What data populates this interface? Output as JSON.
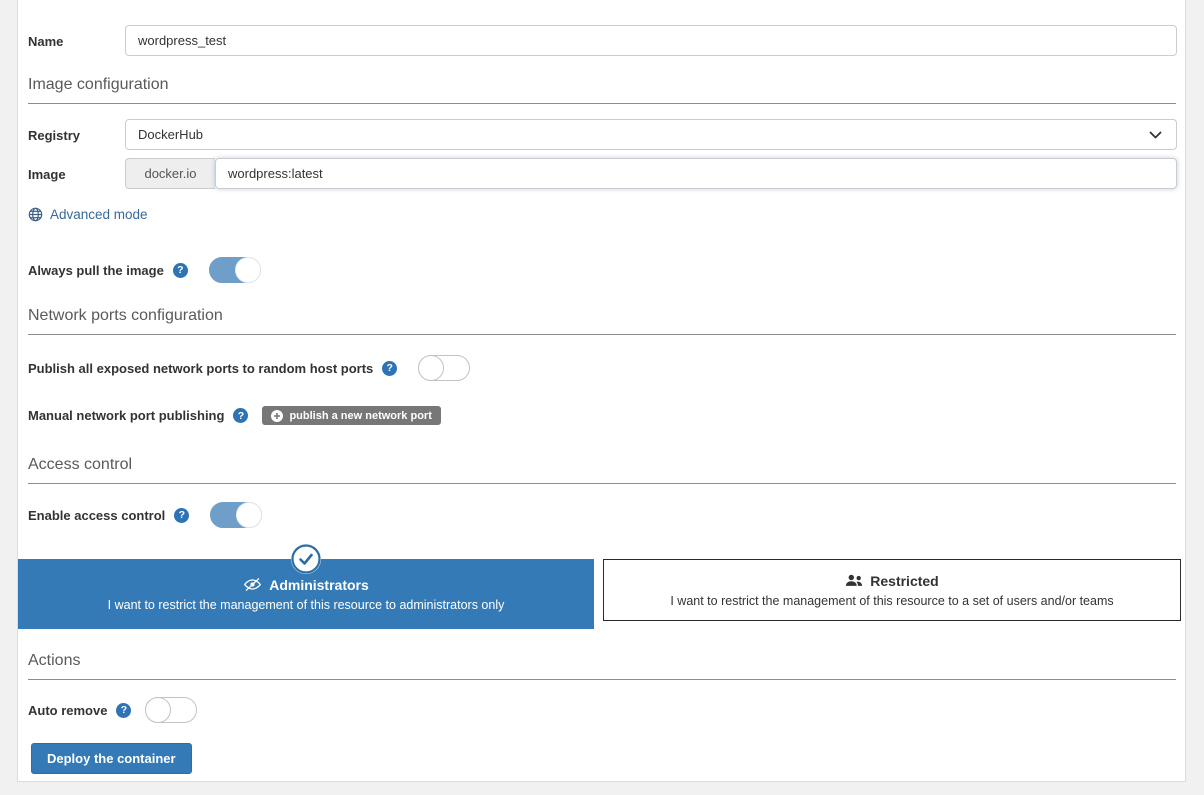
{
  "colors": {
    "accent": "#337ab7",
    "toggle_on": "#6f9fc9",
    "muted_button": "#777777",
    "link": "#37699b",
    "section_underline": "#8c8c8c"
  },
  "name_row": {
    "label": "Name",
    "value": "wordpress_test"
  },
  "image_config": {
    "title": "Image configuration",
    "registry": {
      "label": "Registry",
      "value": "DockerHub"
    },
    "image": {
      "label": "Image",
      "prefix": "docker.io",
      "value": "wordpress:latest"
    },
    "advanced_mode_label": "Advanced mode",
    "advanced_mode_icon": "globe-icon"
  },
  "always_pull": {
    "label": "Always pull the image",
    "enabled": true
  },
  "network": {
    "title": "Network ports configuration",
    "publish_all": {
      "label": "Publish all exposed network ports to random host ports",
      "enabled": false
    },
    "manual": {
      "label": "Manual network port publishing",
      "button_label": "publish a new network port",
      "button_icon": "plus-circle-icon"
    }
  },
  "access_control": {
    "title": "Access control",
    "enable": {
      "label": "Enable access control",
      "enabled": true
    },
    "options": [
      {
        "title": "Administrators",
        "description": "I want to restrict the management of this resource to administrators only",
        "icon": "eye-slash-icon",
        "selected": true
      },
      {
        "title": "Restricted",
        "description": "I want to restrict the management of this resource to a set of users and/or teams",
        "icon": "users-icon",
        "selected": false
      }
    ],
    "selected_badge_icon": "check-circle-icon"
  },
  "actions": {
    "title": "Actions",
    "auto_remove": {
      "label": "Auto remove",
      "enabled": false
    },
    "deploy_label": "Deploy the container"
  }
}
